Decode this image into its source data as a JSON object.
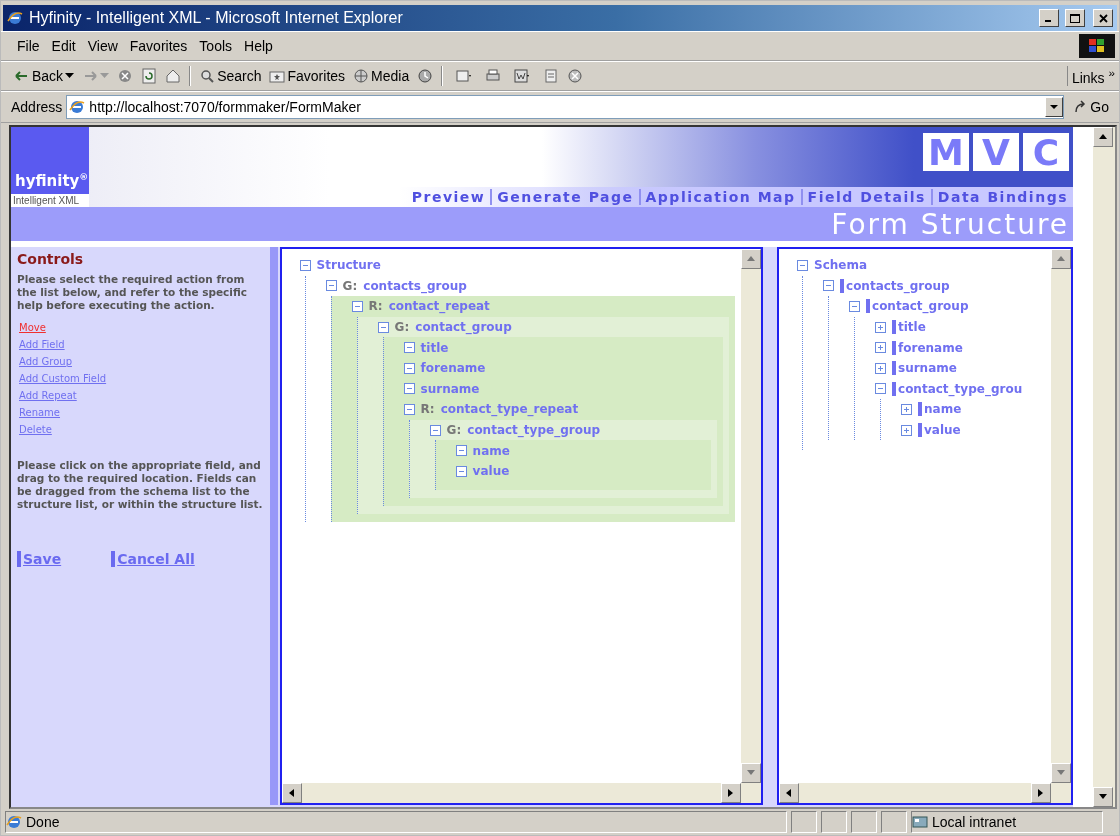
{
  "window": {
    "title": "Hyfinity - Intelligent XML - Microsoft Internet Explorer"
  },
  "menu": [
    "File",
    "Edit",
    "View",
    "Favorites",
    "Tools",
    "Help"
  ],
  "toolbar": [
    {
      "kind": "back",
      "label": "Back"
    },
    {
      "kind": "forward"
    },
    {
      "kind": "stop"
    },
    {
      "kind": "refresh"
    },
    {
      "kind": "home"
    },
    {
      "kind": "search",
      "label": "Search"
    },
    {
      "kind": "favorites",
      "label": "Favorites"
    },
    {
      "kind": "media",
      "label": "Media"
    },
    {
      "kind": "history"
    },
    {
      "kind": "mail"
    },
    {
      "kind": "print"
    },
    {
      "kind": "edit"
    },
    {
      "kind": "discuss"
    },
    {
      "kind": "messenger"
    }
  ],
  "links": {
    "label": "Links",
    "chevron": "»"
  },
  "address": {
    "label": "Address",
    "value": "http://localhost:7070/formmaker/FormMaker",
    "go": "Go"
  },
  "header": {
    "logo": "hyfinity$^{®}$",
    "tagline": "Intelligent XML",
    "mvc": [
      "M",
      "V",
      "C"
    ],
    "nav": [
      {
        "label": "Preview"
      },
      {
        "label": "Generate Page"
      },
      {
        "label": "Application Map"
      },
      {
        "label": "Field Details"
      },
      {
        "label": "Data Bindings"
      }
    ],
    "page_title": "Form Structure"
  },
  "controls": {
    "title": "Controls",
    "intro": "Please select the required action from the list below, and refer to the specific help before executing the action.",
    "actions": [
      {
        "label": "Move",
        "selected": true
      },
      {
        "label": "Add Field",
        "selected": false
      },
      {
        "label": "Add Group",
        "selected": false
      },
      {
        "label": "Add Custom Field",
        "selected": false
      },
      {
        "label": "Add Repeat",
        "selected": false
      },
      {
        "label": "Rename",
        "selected": false
      },
      {
        "label": "Delete",
        "selected": false
      }
    ],
    "help": "Please click on the appropriate field, and drag to the required location. Fields can be dragged from the schema list to the structure list, or within the structure list.",
    "buttons": [
      "Save",
      "Cancel All"
    ]
  },
  "structure": {
    "label": "Structure",
    "children": [
      {
        "prefix": "G:",
        "label": "contacts_group",
        "children": [
          {
            "prefix": "R:",
            "label": "contact_repeat",
            "children": [
              {
                "prefix": "G:",
                "label": "contact_group",
                "children": [
                  {
                    "label": "title"
                  },
                  {
                    "label": "forename"
                  },
                  {
                    "label": "surname"
                  },
                  {
                    "prefix": "R:",
                    "label": "contact_type_repeat",
                    "children": [
                      {
                        "prefix": "G:",
                        "label": "contact_type_group",
                        "children": [
                          {
                            "label": "name"
                          },
                          {
                            "label": "value"
                          }
                        ]
                      }
                    ]
                  }
                ]
              }
            ]
          }
        ]
      }
    ]
  },
  "schema": {
    "label": "Schema",
    "children": [
      {
        "label": "contacts_group",
        "children": [
          {
            "label": "contact_group",
            "children": [
              {
                "label": "title",
                "expanded": false
              },
              {
                "label": "forename",
                "expanded": false
              },
              {
                "label": "surname",
                "expanded": false
              },
              {
                "label": "contact_type_grou",
                "expanded": true,
                "children": [
                  {
                    "label": "name",
                    "expanded": false
                  },
                  {
                    "label": "value",
                    "expanded": false
                  }
                ]
              }
            ]
          }
        ]
      }
    ]
  },
  "status_bar": {
    "text": "Done",
    "zone": "Local intranet"
  }
}
